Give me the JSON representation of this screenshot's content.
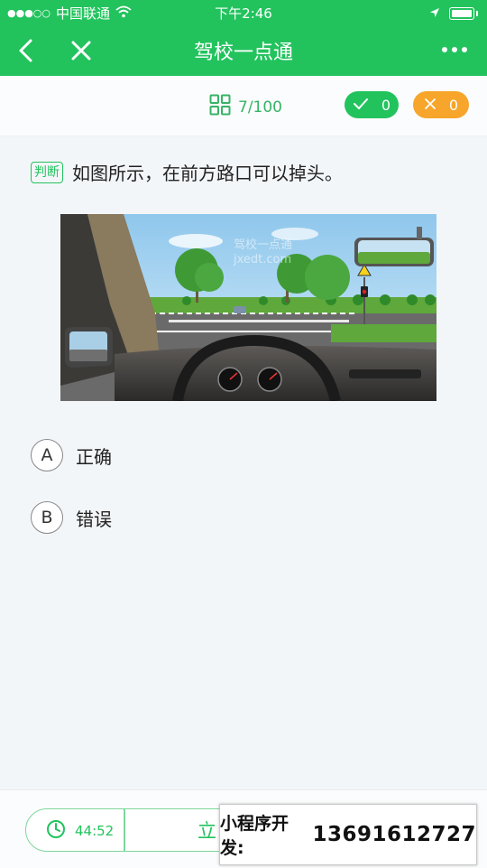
{
  "status_bar": {
    "signal": "●●●○○",
    "carrier": "中国联通",
    "time": "下午2:46"
  },
  "navbar": {
    "title": "驾校一点通"
  },
  "progress": {
    "count": "7/100",
    "correct_count": "0",
    "wrong_count": "0"
  },
  "question": {
    "type_tag": "判断",
    "text": "如图所示，在前方路口可以掉头。",
    "image_watermark_line1": "驾校一点通",
    "image_watermark_line2": "jxedt.com"
  },
  "options": [
    {
      "letter": "A",
      "label": "正确"
    },
    {
      "letter": "B",
      "label": "错误"
    }
  ],
  "bottom_bar": {
    "timer": "44:52",
    "submit_label": "立"
  },
  "overlay": {
    "label": "小程序开发:",
    "phone": "13691612727"
  },
  "colors": {
    "brand_green": "#22c35d",
    "wrong_orange": "#f7a52b",
    "background": "#f3f6f9"
  },
  "icons": [
    "wifi-icon",
    "location-arrow-icon",
    "battery-icon",
    "back-chevron-icon",
    "close-icon",
    "more-icon",
    "grid-icon",
    "check-icon",
    "x-icon",
    "clock-icon"
  ]
}
